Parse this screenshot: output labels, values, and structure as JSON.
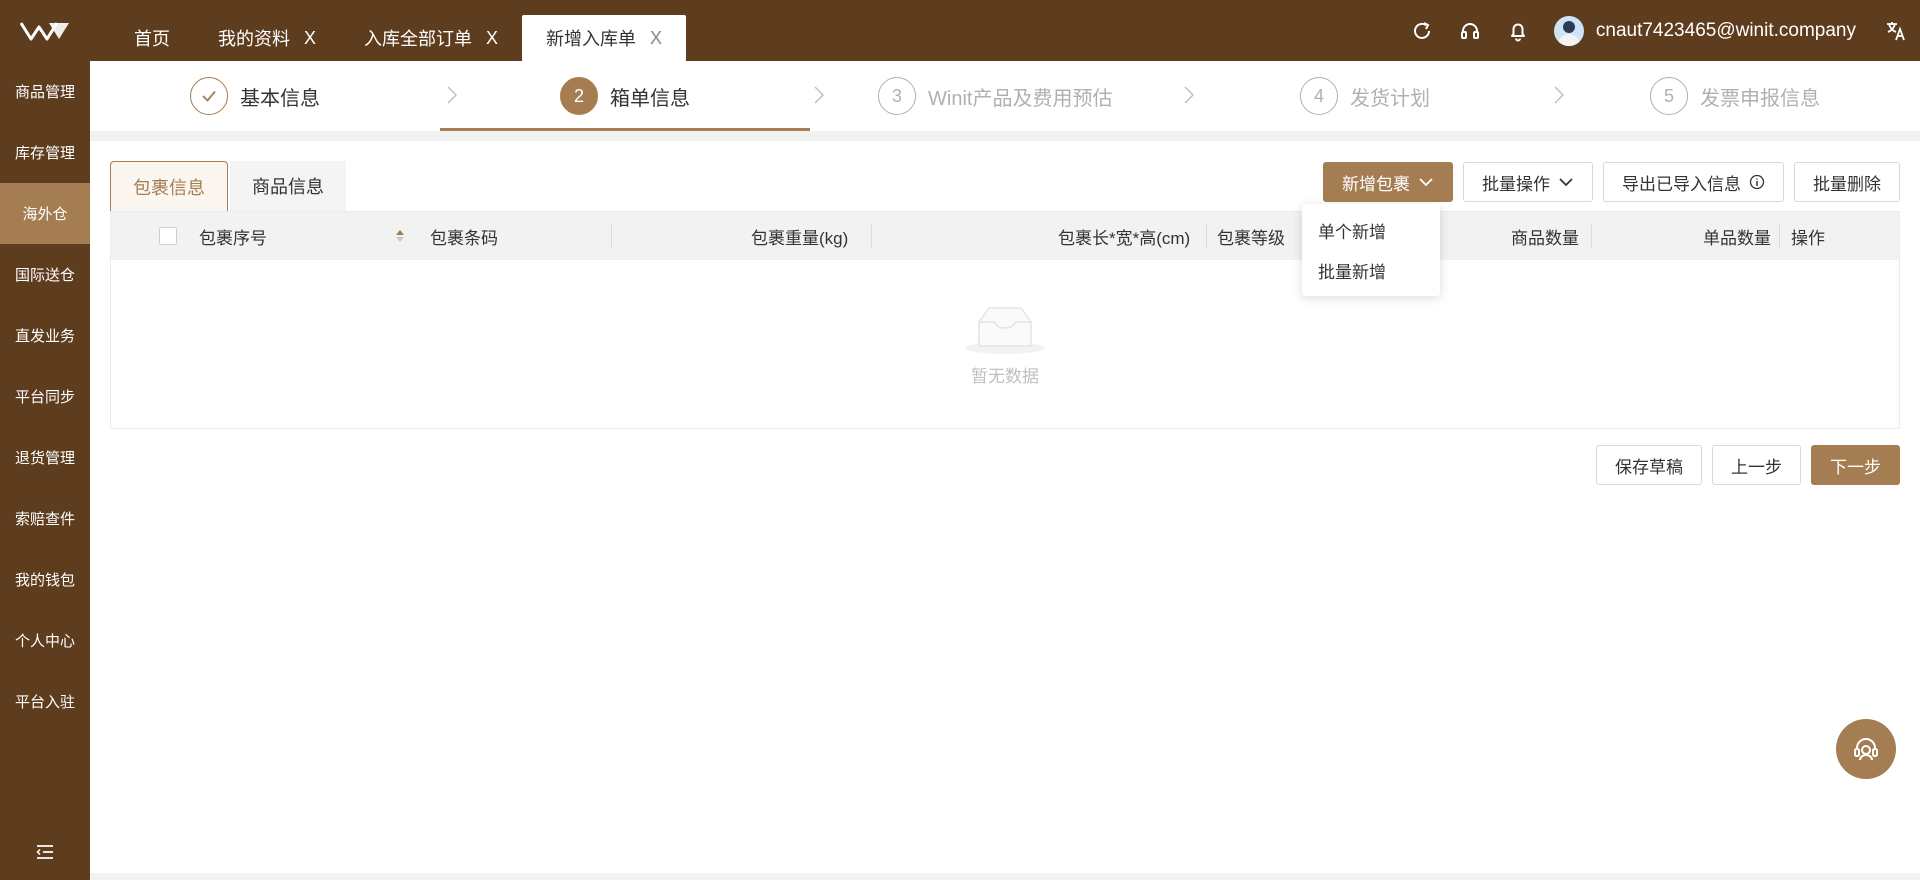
{
  "colors": {
    "brand_dark": "#5e3d1f",
    "brand": "#a57d52",
    "muted": "#b0b0b0"
  },
  "header": {
    "tabs": [
      {
        "label": "首页",
        "closable": false
      },
      {
        "label": "我的资料",
        "closable": true
      },
      {
        "label": "入库全部订单",
        "closable": true
      },
      {
        "label": "新增入库单",
        "closable": true,
        "active": true
      }
    ],
    "close_glyph": "X",
    "user": "cnaut7423465@winit.company",
    "icons": [
      "refresh-icon",
      "headset-icon",
      "bell-icon",
      "translate-icon"
    ]
  },
  "sidebar": {
    "items": [
      {
        "label": "商品管理"
      },
      {
        "label": "库存管理"
      },
      {
        "label": "海外仓",
        "active": true
      },
      {
        "label": "国际送仓"
      },
      {
        "label": "直发业务"
      },
      {
        "label": "平台同步"
      },
      {
        "label": "退货管理"
      },
      {
        "label": "索赔查件"
      },
      {
        "label": "我的钱包"
      },
      {
        "label": "个人中心"
      },
      {
        "label": "平台入驻"
      }
    ]
  },
  "steps": [
    {
      "num": "✓",
      "label": "基本信息",
      "state": "done"
    },
    {
      "num": "2",
      "label": "箱单信息",
      "state": "current"
    },
    {
      "num": "3",
      "label": "Winit产品及费用预估",
      "state": "pending"
    },
    {
      "num": "4",
      "label": "发货计划",
      "state": "pending"
    },
    {
      "num": "5",
      "label": "发票申报信息",
      "state": "pending"
    }
  ],
  "content_tabs": [
    {
      "label": "包裹信息",
      "active": true
    },
    {
      "label": "商品信息"
    }
  ],
  "actions": {
    "add_package": "新增包裹",
    "batch_ops": "批量操作",
    "export_imported": "导出已导入信息",
    "batch_delete": "批量删除"
  },
  "dropdown": [
    "单个新增",
    "批量新增"
  ],
  "table": {
    "columns": {
      "seq": "包裹序号",
      "barcode": "包裹条码",
      "weight": "包裹重量(kg)",
      "dims": "包裹长*宽*高(cm)",
      "level": "包裹等级",
      "goods_qty": "商品数量",
      "unit_qty": "单品数量",
      "ops": "操作"
    },
    "empty_text": "暂无数据"
  },
  "footer": {
    "save_draft": "保存草稿",
    "prev": "上一步",
    "next": "下一步"
  }
}
